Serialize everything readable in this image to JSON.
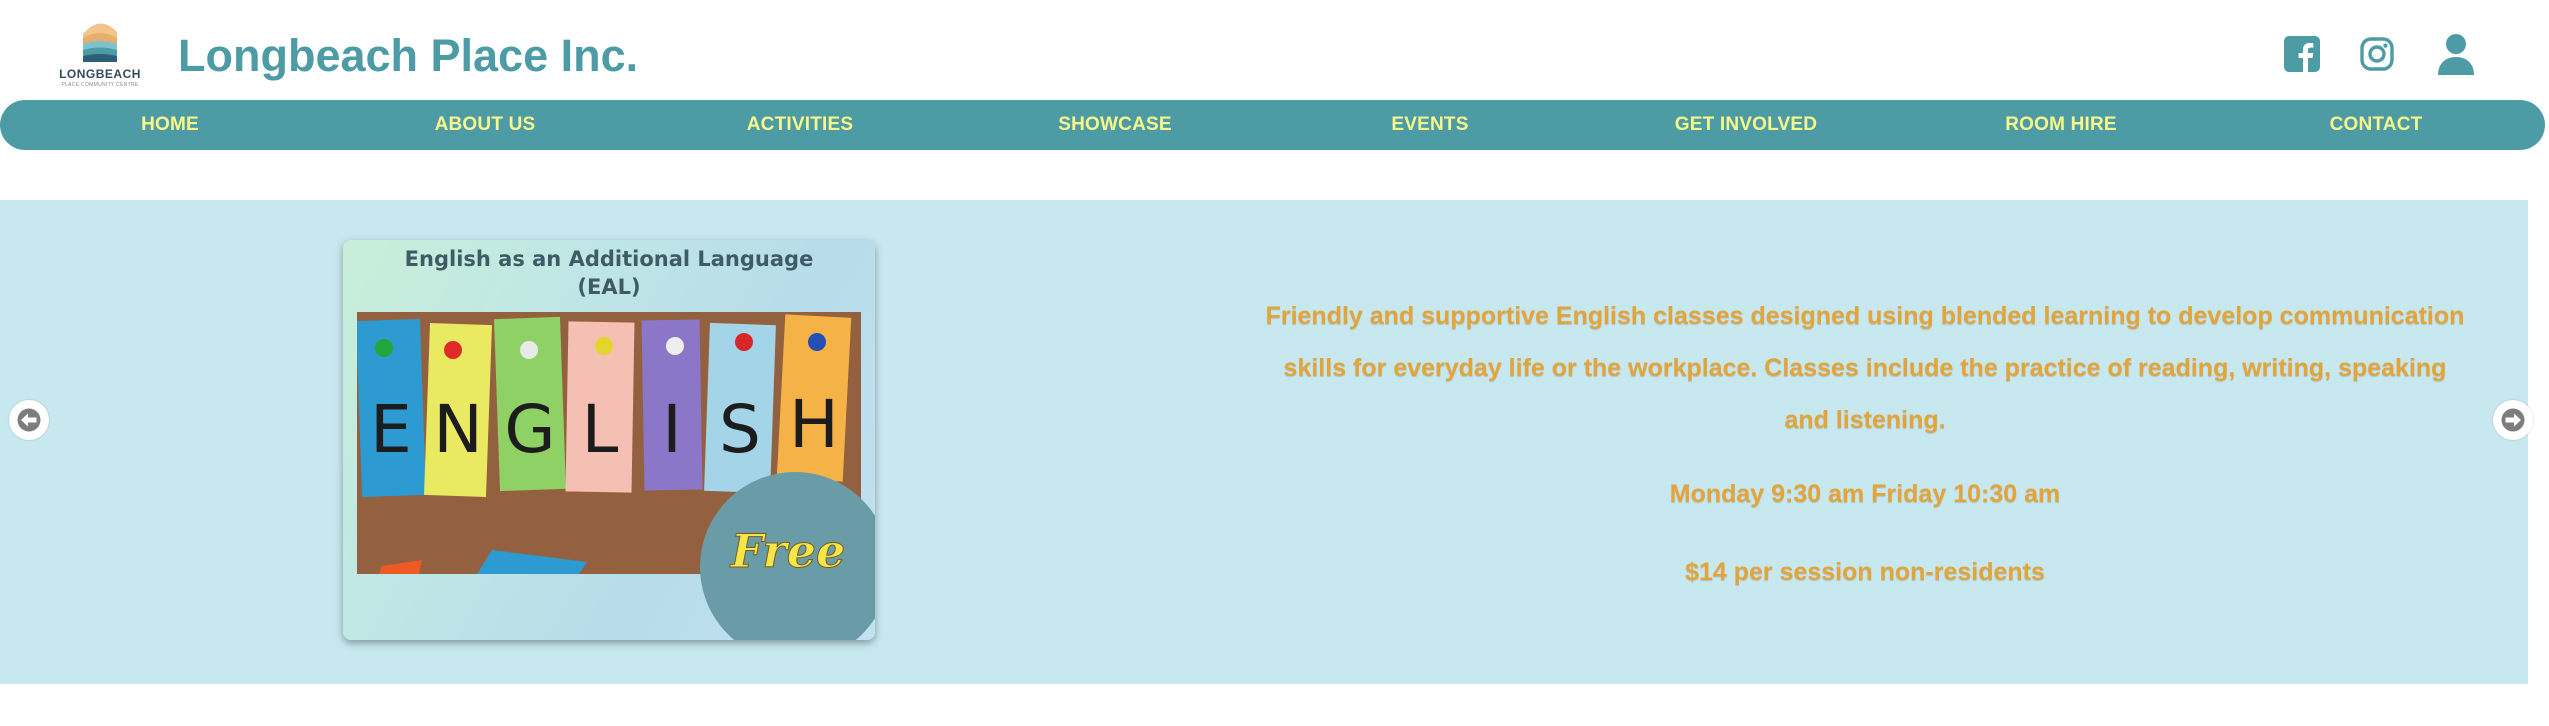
{
  "brand": {
    "logo_text": "LONGBEACH",
    "logo_subtext": "PLACE COMMUNITY CENTRE",
    "site_title": "Longbeach Place Inc."
  },
  "header": {
    "social_icons": [
      "facebook-icon",
      "instagram-icon",
      "user-account-icon"
    ]
  },
  "nav": {
    "items": [
      {
        "label": "HOME"
      },
      {
        "label": "ABOUT US"
      },
      {
        "label": "ACTIVITIES"
      },
      {
        "label": "SHOWCASE"
      },
      {
        "label": "EVENTS"
      },
      {
        "label": "GET INVOLVED"
      },
      {
        "label": "ROOM HIRE"
      },
      {
        "label": "CONTACT"
      }
    ]
  },
  "slide": {
    "card_title_line1": "English as an Additional Language",
    "card_title_line2": "(EAL)",
    "photo_letters": [
      "E",
      "N",
      "G",
      "L",
      "I",
      "S",
      "H"
    ],
    "badge": "Free",
    "description": "Friendly and supportive English classes designed using blended learning to develop communication skills for everyday life or the workplace. Classes include the practice of reading, writing, speaking and listening.",
    "schedule": "Monday 9:30 am Friday 10:30 am",
    "price": "$14 per session non-residents"
  },
  "colors": {
    "brand_teal": "#4d9ca5",
    "nav_text": "#f7f78a",
    "hero_bg": "#c8e8f0",
    "accent_orange": "#e3a539",
    "badge_circle": "#6a9ca8",
    "badge_text": "#f7e64a"
  }
}
